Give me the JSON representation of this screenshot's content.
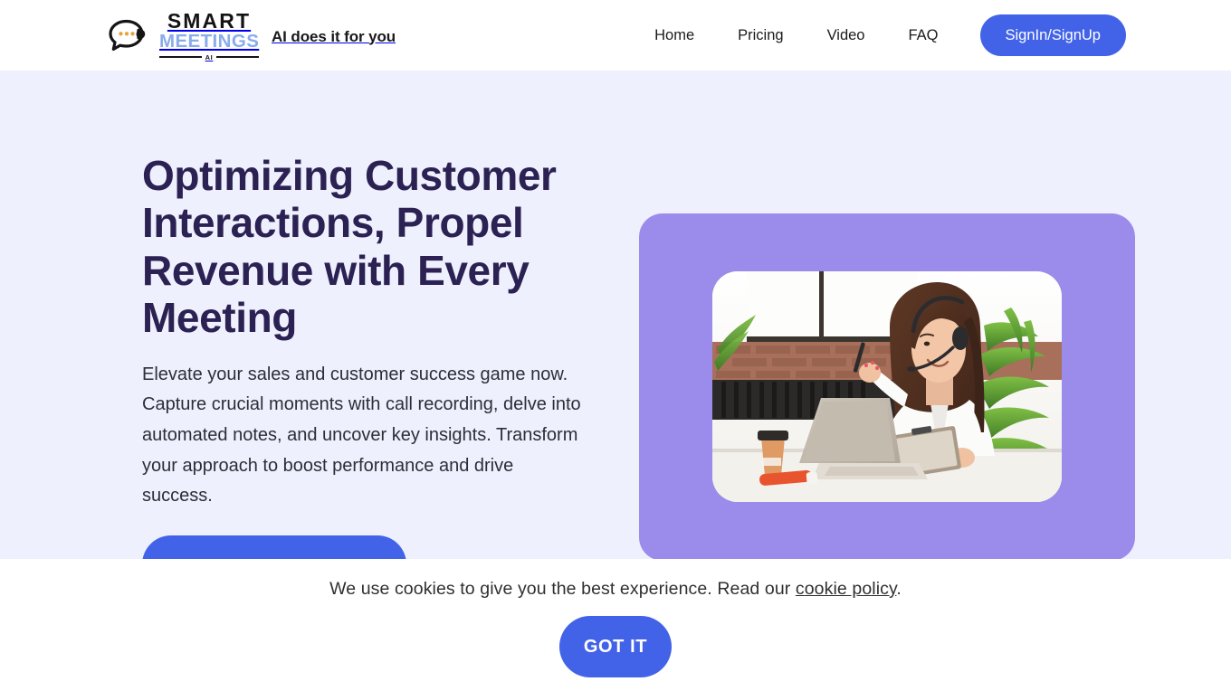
{
  "header": {
    "logo": {
      "mark_icon": "speech-bubble-headset-icon",
      "word_top": "SMART",
      "word_bottom": "MEETINGS",
      "word_sub": "AI",
      "colors": {
        "smart": "#141414",
        "meetings": "#8aacea"
      }
    },
    "tagline": "AI does it for you",
    "nav_items": [
      {
        "label": "Home"
      },
      {
        "label": "Pricing"
      },
      {
        "label": "Video"
      },
      {
        "label": "FAQ"
      }
    ],
    "signin_label": "SignIn/SignUp",
    "accent_color": "#4263e8"
  },
  "hero": {
    "title": "Optimizing Customer Interactions, Propel Revenue with Every Meeting",
    "subtitle": "Elevate your sales and customer success game now. Capture crucial moments with call recording, delve into automated notes, and uncover key insights. Transform your approach to boost performance and drive success.",
    "cta_label": "",
    "background_color": "#eef0fd",
    "title_color": "#2b2152",
    "card_color": "#9b8ceb",
    "image_alt": "woman-with-headset-at-laptop-photo"
  },
  "cookie_banner": {
    "message_before_link": "We use cookies to give you the best experience. Read our ",
    "link_label": "cookie policy",
    "message_after_link": ".",
    "accept_label": "GOT IT",
    "background_color": "#ffffff",
    "button_color": "#4263e8"
  }
}
